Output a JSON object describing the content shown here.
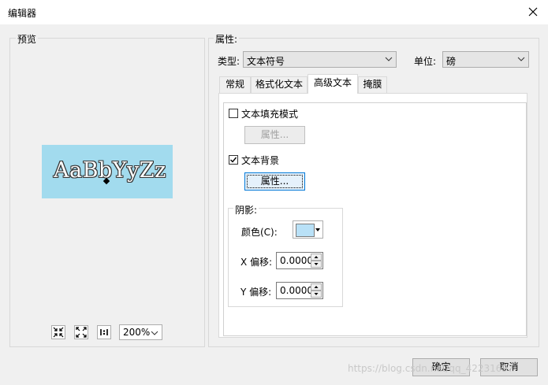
{
  "window": {
    "title": "编辑器"
  },
  "preview": {
    "legend": "预览",
    "sample_text": "AaBbYyZz",
    "zoom": "200%",
    "colors": {
      "background": "#a2dbee",
      "text": "#ffffff",
      "outline": "#333333"
    }
  },
  "properties": {
    "legend": "属性:",
    "type_label": "类型:",
    "type_value": "文本符号",
    "unit_label": "单位:",
    "unit_value": "磅",
    "tabs": [
      "常规",
      "格式化文本",
      "高级文本",
      "掩膜"
    ],
    "active_tab": "高级文本",
    "fill_pattern": {
      "label": "文本填充模式",
      "checked": false,
      "button": "属性..."
    },
    "text_background": {
      "label": "文本背景",
      "checked": true,
      "button": "属性..."
    },
    "shadow": {
      "legend": "阴影:",
      "color_label": "颜色(C):",
      "color": "#b9e1f7",
      "x_label": "X 偏移:",
      "x_value": "0.0000",
      "y_label": "Y 偏移:",
      "y_value": "0.0000"
    }
  },
  "footer": {
    "ok": "确定",
    "cancel": "取消"
  },
  "watermark": "https://blog.csdn.net/qq_42231697"
}
